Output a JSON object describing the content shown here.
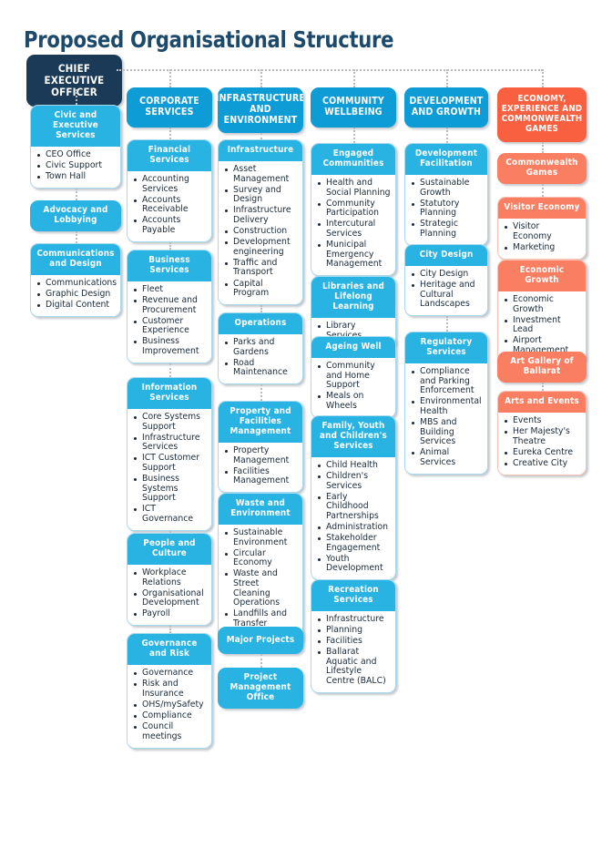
{
  "page": {
    "title": "Proposed Organisational Structure"
  },
  "colors": {
    "ceo": "#1b3a57",
    "division_blue": "#0d9cd6",
    "branch_blue": "#29b3e3",
    "division_orange": "#f9603f",
    "branch_orange": "#fa7f62",
    "title_navy": "#1d4a6b",
    "connector_gray": "#b9bcbe"
  },
  "ceo": {
    "label": "CHIEF EXECUTIVE OFFICER"
  },
  "columns": [
    {
      "key": "ceo-office",
      "division": null,
      "branches": [
        {
          "label": "Civic and Executive Services",
          "items": [
            "CEO Office",
            "Civic Support",
            "Town Hall"
          ]
        },
        {
          "label": "Advocacy and Lobbying",
          "items": []
        },
        {
          "label": "Communications and Design",
          "items": [
            "Communications",
            "Graphic Design",
            "Digital Content"
          ]
        }
      ]
    },
    {
      "key": "corporate-services",
      "division": "CORPORATE SERVICES",
      "branches": [
        {
          "label": "Financial Services",
          "items": [
            "Accounting Services",
            "Accounts Receivable",
            "Accounts Payable"
          ]
        },
        {
          "label": "Business Services",
          "items": [
            "Fleet",
            "Revenue and Procurement",
            "Customer Experience",
            "Business Improvement"
          ]
        },
        {
          "label": "Information Services",
          "items": [
            "Core Systems Support",
            "Infrastructure Services",
            "ICT Customer Support",
            "Business Systems Support",
            "ICT Governance"
          ]
        },
        {
          "label": "People and Culture",
          "items": [
            "Workplace Relations",
            "Organisational Development",
            "Payroll"
          ]
        },
        {
          "label": "Governance and Risk",
          "items": [
            "Governance",
            "Risk and Insurance",
            "OHS/mySafety",
            "Compliance",
            "Council meetings"
          ]
        }
      ]
    },
    {
      "key": "infrastructure-and-environment",
      "division": "INFRASTRUCTURE AND ENVIRONMENT",
      "branches": [
        {
          "label": "Infrastructure",
          "items": [
            "Asset Management",
            "Survey and Design",
            "Infrastructure Delivery",
            "Construction",
            "Development engineering",
            "Traffic and Transport",
            "Capital Program"
          ]
        },
        {
          "label": "Operations",
          "items": [
            "Parks and Gardens",
            "Road Maintenance"
          ]
        },
        {
          "label": "Property and Facilities Management",
          "items": [
            "Property Management",
            "Facilities Management"
          ]
        },
        {
          "label": "Waste and Environment",
          "items": [
            "Sustainable Environment",
            "Circular Economy",
            "Waste and Street Cleaning Operations",
            "Landfills and Transfer Station"
          ]
        },
        {
          "label": "Major Projects",
          "items": []
        },
        {
          "label": "Project Management Office",
          "items": []
        }
      ]
    },
    {
      "key": "community-wellbeing",
      "division": "COMMUNITY WELLBEING",
      "branches": [
        {
          "label": "Engaged Communities",
          "items": [
            "Health and Social Planning",
            "Community Participation",
            "Intercutural Services",
            "Municipal Emergency Management"
          ]
        },
        {
          "label": "Libraries and Lifelong Learning",
          "items": [
            "Library Services"
          ]
        },
        {
          "label": "Ageing Well",
          "items": [
            "Community and Home Support",
            "Meals on Wheels"
          ]
        },
        {
          "label": "Family, Youth and Children's Services",
          "items": [
            "Child Health",
            "Children's Services",
            "Early Childhood Partnerships",
            "Administration",
            "Stakeholder Engagement",
            "Youth Development"
          ]
        },
        {
          "label": "Recreation Services",
          "items": [
            "Infrastructure",
            "Planning",
            "Facilities",
            "Ballarat Aquatic and Lifestyle Centre (BALC)"
          ]
        }
      ]
    },
    {
      "key": "development-and-growth",
      "division": "DEVELOPMENT AND GROWTH",
      "branches": [
        {
          "label": "Development Facilitation",
          "items": [
            "Sustainable Growth",
            "Statutory Planning",
            "Strategic Planning"
          ]
        },
        {
          "label": "City Design",
          "items": [
            "City Design",
            "Heritage and Cultural Landscapes"
          ]
        },
        {
          "label": "Regulatory Services",
          "items": [
            "Compliance and Parking Enforcement",
            "Environmental Health",
            "MBS and Building Services",
            "Animal Services"
          ]
        }
      ]
    },
    {
      "key": "economy-experience-commonwealth-games",
      "division": "ECONOMY, EXPERIENCE AND COMMONWEALTH GAMES",
      "accent": "orange",
      "branches": [
        {
          "label": "Commonwealth Games",
          "items": []
        },
        {
          "label": "Visitor Economy",
          "items": [
            "Visitor Economy",
            "Marketing"
          ]
        },
        {
          "label": "Economic Growth",
          "items": [
            "Economic Growth",
            "Investment Lead",
            "Airport Management"
          ]
        },
        {
          "label": "Art Gallery of Ballarat",
          "items": []
        },
        {
          "label": "Arts and Events",
          "items": [
            "Events",
            "Her Majesty's Theatre",
            "Eureka Centre",
            "Creative City"
          ]
        }
      ]
    }
  ]
}
